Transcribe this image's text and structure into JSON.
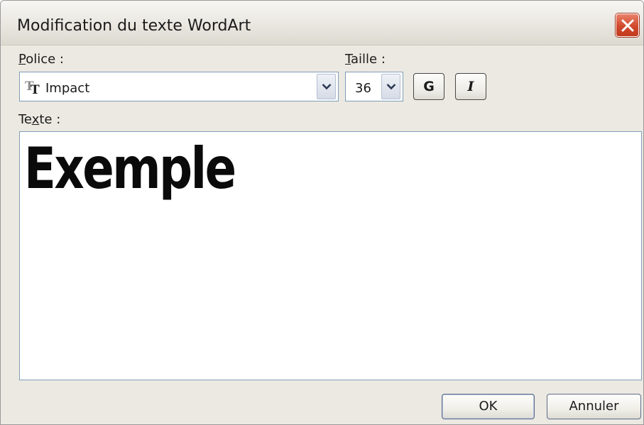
{
  "window": {
    "title": "Modification du texte WordArt",
    "close_icon": "close-icon"
  },
  "font": {
    "label_accel": "P",
    "label_rest": "olice :",
    "value": "Impact",
    "icon": "truetype-font-icon"
  },
  "size": {
    "label_accel": "T",
    "label_rest": "aille :",
    "value": "36"
  },
  "format": {
    "bold_label": "G",
    "italic_label": "I"
  },
  "text": {
    "label_pre": "Te",
    "label_accel": "x",
    "label_rest": "te :",
    "value": "Exemple"
  },
  "buttons": {
    "ok": "OK",
    "cancel": "Annuler"
  },
  "colors": {
    "close_button": "#d1492c",
    "input_border": "#7f9db9",
    "dialog_background": "#ebe9e1"
  }
}
